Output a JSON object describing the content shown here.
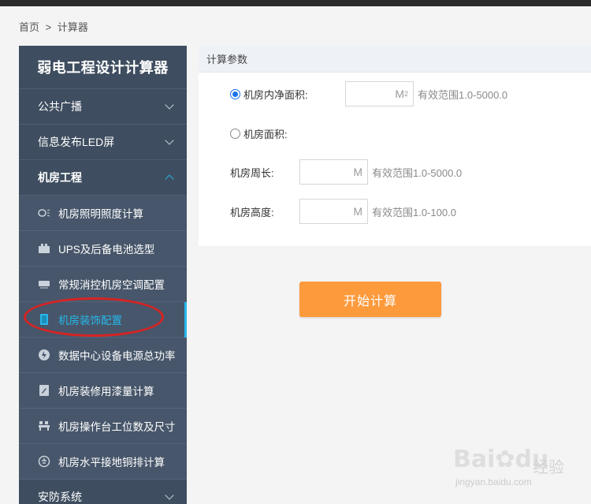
{
  "breadcrumb": {
    "home": "首页",
    "separator": ">",
    "current": "计算器"
  },
  "sidebar": {
    "title": "弱电工程设计计算器",
    "groups": [
      {
        "label": "公共广播"
      },
      {
        "label": "信息发布LED屏"
      },
      {
        "label": "机房工程"
      }
    ],
    "items": [
      {
        "label": "机房照明照度计算",
        "icon": "light-icon"
      },
      {
        "label": "UPS及后备电池选型",
        "icon": "battery-icon"
      },
      {
        "label": "常规消控机房空调配置",
        "icon": "aircon-icon"
      },
      {
        "label": "机房装饰配置",
        "icon": "door-icon"
      },
      {
        "label": "数据中心设备电源总功率",
        "icon": "power-icon"
      },
      {
        "label": "机房装修用漆量计算",
        "icon": "paint-icon"
      },
      {
        "label": "机房操作台工位数及尺寸",
        "icon": "desk-icon"
      },
      {
        "label": "机房水平接地铜排计算",
        "icon": "ground-icon"
      }
    ],
    "bottom_group": {
      "label": "安防系统"
    }
  },
  "panel": {
    "header": "计算参数",
    "option_net_area": {
      "label": "机房内净面积:",
      "unit": "M",
      "unit_sup": "2",
      "hint": "有效范围1.0-5000.0"
    },
    "option_area": {
      "label": "机房面积:"
    },
    "perimeter": {
      "label": "机房周长:",
      "unit": "M",
      "hint": "有效范围1.0-5000.0"
    },
    "height": {
      "label": "机房高度:",
      "unit": "M",
      "hint": "有效范围1.0-100.0"
    }
  },
  "action": {
    "calculate_label": "开始计算"
  },
  "watermark": {
    "brand": "Bai",
    "brand2": "du",
    "cn": "经验",
    "url": "jingyan.baidu.com"
  },
  "colors": {
    "sidebar_bg": "#3e4d5f",
    "active": "#27b7ea",
    "button": "#fd9a3c",
    "highlight": "#d72323"
  }
}
